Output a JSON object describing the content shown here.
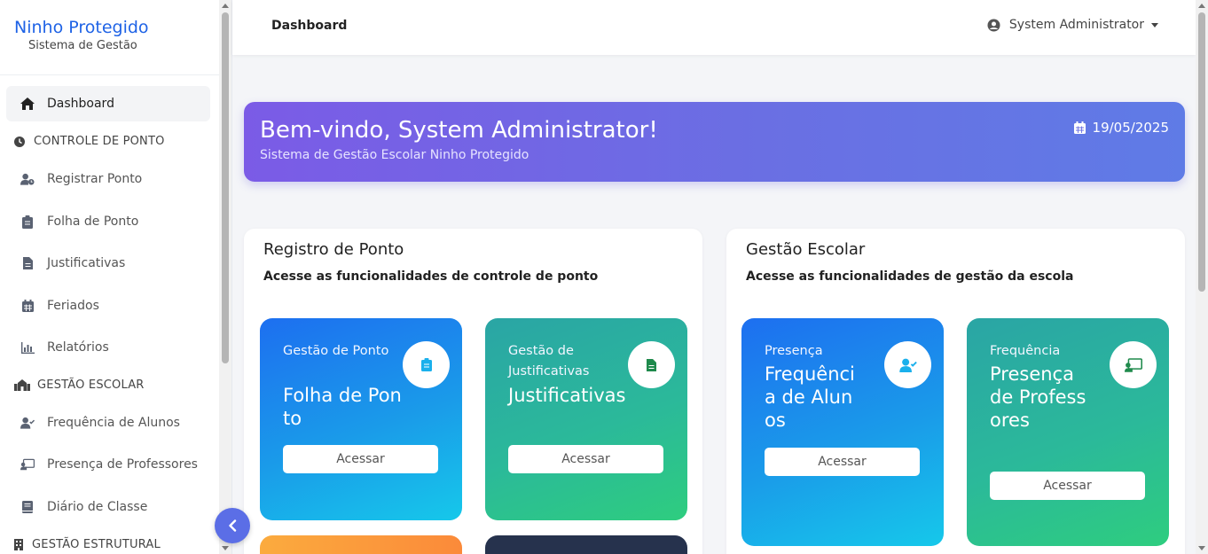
{
  "brand": {
    "title": "Ninho Protegido",
    "subtitle": "Sistema de Gestão"
  },
  "sidebar": {
    "dashboard": "Dashboard",
    "section_ponto": "CONTROLE DE PONTO",
    "registrar_ponto": "Registrar Ponto",
    "folha_ponto": "Folha de Ponto",
    "justificativas": "Justificativas",
    "feriados": "Feriados",
    "relatorios": "Relatórios",
    "section_escolar": "GESTÃO ESCOLAR",
    "frequencia_alunos": "Frequência de Alunos",
    "presenca_professores": "Presença de Professores",
    "diario_classe": "Diário de Classe",
    "section_estrutural": "GESTÃO ESTRUTURAL"
  },
  "topbar": {
    "title": "Dashboard",
    "user": "System Administrator"
  },
  "banner": {
    "title": "Bem-vindo, System Administrator!",
    "subtitle": "Sistema de Gestão Escolar Ninho Protegido",
    "date": "19/05/2025"
  },
  "panel_ponto": {
    "title": "Registro de Ponto",
    "subtitle": "Acesse as funcionalidades de controle de ponto",
    "cards": [
      {
        "label": "Gestão de Ponto",
        "value": "Folha de Ponto",
        "button": "Acessar",
        "icon": "clipboard-icon"
      },
      {
        "label": "Gestão de Justificativas",
        "value": "Justificativas",
        "button": "Acessar",
        "icon": "file-icon"
      }
    ]
  },
  "panel_escolar": {
    "title": "Gestão Escolar",
    "subtitle": "Acesse as funcionalidades de gestão da escola",
    "cards": [
      {
        "label": "Presença",
        "value": "Frequência de Alunos",
        "button": "Acessar",
        "icon": "user-check-icon"
      },
      {
        "label": "Frequência",
        "value": "Presença de Professores",
        "button": "Acessar",
        "icon": "chalkboard-teacher-icon"
      }
    ]
  },
  "colors": {
    "brand": "#1f63e6",
    "banner_start": "#7b5be6",
    "banner_end": "#5f7be6",
    "card_blue": "#1d6ff0",
    "card_green": "#2ecd7f",
    "card_orange": "#fb8a3a",
    "card_navy": "#26324d",
    "collapse_button": "#5b6ee6"
  }
}
